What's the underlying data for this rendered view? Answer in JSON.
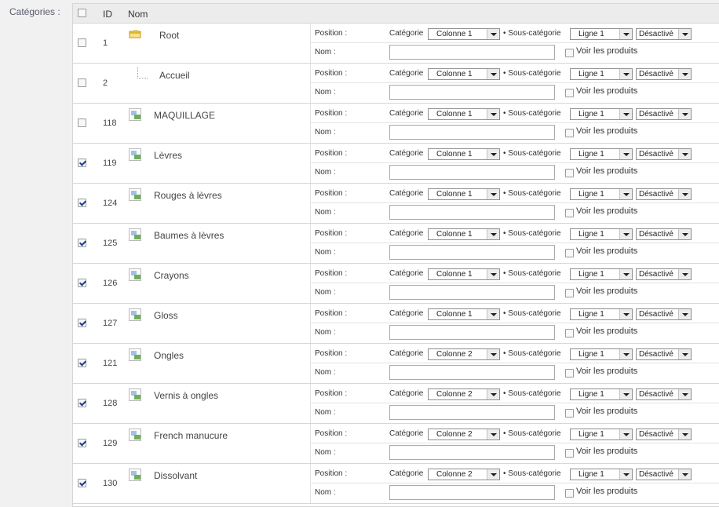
{
  "field_label": "Catégories :",
  "header": {
    "id": "ID",
    "name": "Nom",
    "select_all_checked": false
  },
  "labels": {
    "position": "Position :",
    "categorie": "Catégorie",
    "sous_categorie": "Sous-catégorie",
    "bullet": "•",
    "nom": "Nom :",
    "voir": "Voir les produits"
  },
  "rows": [
    {
      "checked": false,
      "id": "1",
      "icon": "folder-icon",
      "name": "Root",
      "colonne": "Colonne 1",
      "ligne": "Ligne 1",
      "etat": "Désactivé"
    },
    {
      "checked": false,
      "id": "2",
      "icon": "tree-branch-icon",
      "name": "Accueil",
      "colonne": "Colonne 1",
      "ligne": "Ligne 1",
      "etat": "Désactivé"
    },
    {
      "checked": false,
      "id": "118",
      "icon": "broken-image-icon",
      "name": "MAQUILLAGE",
      "colonne": "Colonne 1",
      "ligne": "Ligne 1",
      "etat": "Désactivé"
    },
    {
      "checked": true,
      "id": "119",
      "icon": "broken-image-icon",
      "name": "Lèvres",
      "colonne": "Colonne 1",
      "ligne": "Ligne 1",
      "etat": "Désactivé"
    },
    {
      "checked": true,
      "id": "124",
      "icon": "broken-image-icon",
      "name": "Rouges à lèvres",
      "colonne": "Colonne 1",
      "ligne": "Ligne 1",
      "etat": "Désactivé"
    },
    {
      "checked": true,
      "id": "125",
      "icon": "broken-image-icon",
      "name": "Baumes à lèvres",
      "colonne": "Colonne 1",
      "ligne": "Ligne 1",
      "etat": "Désactivé"
    },
    {
      "checked": true,
      "id": "126",
      "icon": "broken-image-icon",
      "name": "Crayons",
      "colonne": "Colonne 1",
      "ligne": "Ligne 1",
      "etat": "Désactivé"
    },
    {
      "checked": true,
      "id": "127",
      "icon": "broken-image-icon",
      "name": "Gloss",
      "colonne": "Colonne 1",
      "ligne": "Ligne 1",
      "etat": "Désactivé"
    },
    {
      "checked": true,
      "id": "121",
      "icon": "broken-image-icon",
      "name": "Ongles",
      "colonne": "Colonne 2",
      "ligne": "Ligne 1",
      "etat": "Désactivé"
    },
    {
      "checked": true,
      "id": "128",
      "icon": "broken-image-icon",
      "name": "Vernis à ongles",
      "colonne": "Colonne 2",
      "ligne": "Ligne 1",
      "etat": "Désactivé"
    },
    {
      "checked": true,
      "id": "129",
      "icon": "broken-image-icon",
      "name": "French manucure",
      "colonne": "Colonne 2",
      "ligne": "Ligne 1",
      "etat": "Désactivé"
    },
    {
      "checked": true,
      "id": "130",
      "icon": "broken-image-icon",
      "name": "Dissolvant",
      "colonne": "Colonne 2",
      "ligne": "Ligne 1",
      "etat": "Désactivé"
    }
  ]
}
